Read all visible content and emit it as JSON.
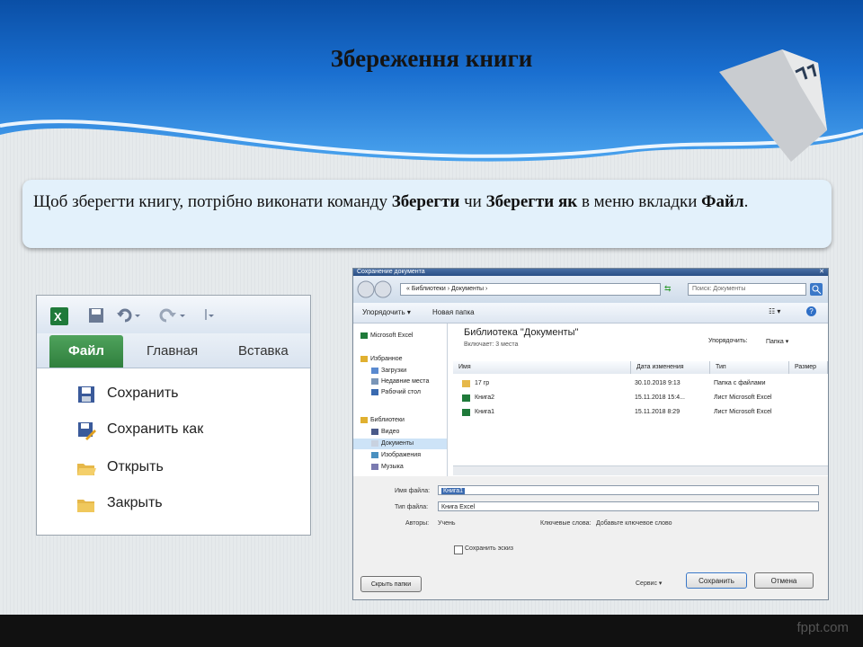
{
  "slide": {
    "title": "Збереження книги",
    "body": {
      "p1": "Щоб зберегти книгу, потрібно виконати команду ",
      "b1": "Зберегти",
      "p2": " чи ",
      "b2": "Зберегти як",
      "p3": " в меню вкладки ",
      "b3": "Файл",
      "p4": "."
    },
    "watermark": "fppt.com"
  },
  "ribbon": {
    "tabs": {
      "file": "Файл",
      "home": "Главная",
      "insert": "Вставка"
    },
    "menu": [
      {
        "label": "Сохранить",
        "icon": "floppy-disk-icon"
      },
      {
        "label": "Сохранить как",
        "icon": "save-as-icon"
      },
      {
        "label": "Открыть",
        "icon": "open-folder-icon"
      },
      {
        "label": "Закрыть",
        "icon": "close-folder-icon"
      }
    ]
  },
  "dialog": {
    "title": "Сохранение документа",
    "address": "« Библиотеки › Документы ›",
    "search_placeholder": "Поиск: Документы",
    "toolbar": {
      "organize": "Упорядочить ▾",
      "new_folder": "Новая папка"
    },
    "nav": [
      "Microsoft Excel",
      "Избранное",
      "Загрузки",
      "Недавние места",
      "Рабочий стол",
      "Библиотеки",
      "Видео",
      "Документы",
      "Изображения",
      "Музыка"
    ],
    "library_title": "Библиотека \"Документы\"",
    "library_sub": "Включает: 3 места",
    "arrange_label": "Упорядочить:",
    "arrange_value": "Папка ▾",
    "columns": [
      "Имя",
      "Дата изменения",
      "Тип",
      "Размер"
    ],
    "files": [
      {
        "name": "17 гр",
        "date": "30.10.2018 9:13",
        "type": "Папка с файлами"
      },
      {
        "name": "Книга2",
        "date": "15.11.2018 15:4...",
        "type": "Лист Microsoft Excel"
      },
      {
        "name": "Книга1",
        "date": "15.11.2018 8:29",
        "type": "Лист Microsoft Excel"
      }
    ],
    "filename_label": "Имя файла:",
    "filename_value": "Книга1",
    "filetype_label": "Тип файла:",
    "filetype_value": "Книга Excel",
    "authors_label": "Авторы:",
    "authors_value": "Учень",
    "tags_label": "Ключевые слова:",
    "tags_value": "Добавьте ключевое слово",
    "thumbnail_label": "Сохранить эскиз",
    "hide_folders": "Скрыть папки",
    "service": "Сервис ▾",
    "save": "Сохранить",
    "cancel": "Отмена"
  }
}
